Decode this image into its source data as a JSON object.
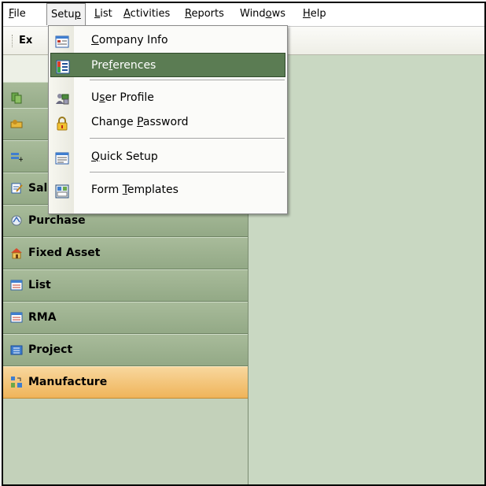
{
  "menubar": {
    "items": [
      {
        "pre": "",
        "u": "F",
        "post": "ile"
      },
      {
        "pre": "Setu",
        "u": "p",
        "post": ""
      },
      {
        "pre": "",
        "u": "L",
        "post": "ist"
      },
      {
        "pre": "",
        "u": "A",
        "post": "ctivities"
      },
      {
        "pre": "",
        "u": "R",
        "post": "eports"
      },
      {
        "pre": "Wind",
        "u": "o",
        "post": "ws"
      },
      {
        "pre": "",
        "u": "H",
        "post": "elp"
      }
    ]
  },
  "toolbar": {
    "button_label": "Ex"
  },
  "setup_menu": {
    "items": [
      {
        "pre": "",
        "u": "C",
        "post": "ompany Info",
        "icon": "company-info-icon"
      },
      {
        "pre": "Pre",
        "u": "f",
        "post": "erences",
        "icon": "preferences-icon"
      },
      {
        "pre": "U",
        "u": "s",
        "post": "er Profile",
        "icon": "user-profile-icon"
      },
      {
        "pre": "Change ",
        "u": "P",
        "post": "assword",
        "icon": "lock-icon"
      },
      {
        "pre": "",
        "u": "Q",
        "post": "uick Setup",
        "icon": "quick-setup-icon"
      },
      {
        "pre": "Form ",
        "u": "T",
        "post": "emplates",
        "icon": "form-templates-icon"
      }
    ]
  },
  "nav": {
    "items": [
      {
        "label": "Sales",
        "icon": "sales-icon"
      },
      {
        "label": "Purchase",
        "icon": "purchase-icon"
      },
      {
        "label": "Fixed Asset",
        "icon": "fixed-asset-icon"
      },
      {
        "label": "List",
        "icon": "list-icon"
      },
      {
        "label": "RMA",
        "icon": "rma-icon"
      },
      {
        "label": "Project",
        "icon": "project-icon"
      },
      {
        "label": "Manufacture",
        "icon": "manufacture-icon"
      }
    ]
  },
  "colors": {
    "workspace": "#c9d8c2",
    "highlight": "#5b7c53",
    "selected_nav": "#efb45a"
  }
}
